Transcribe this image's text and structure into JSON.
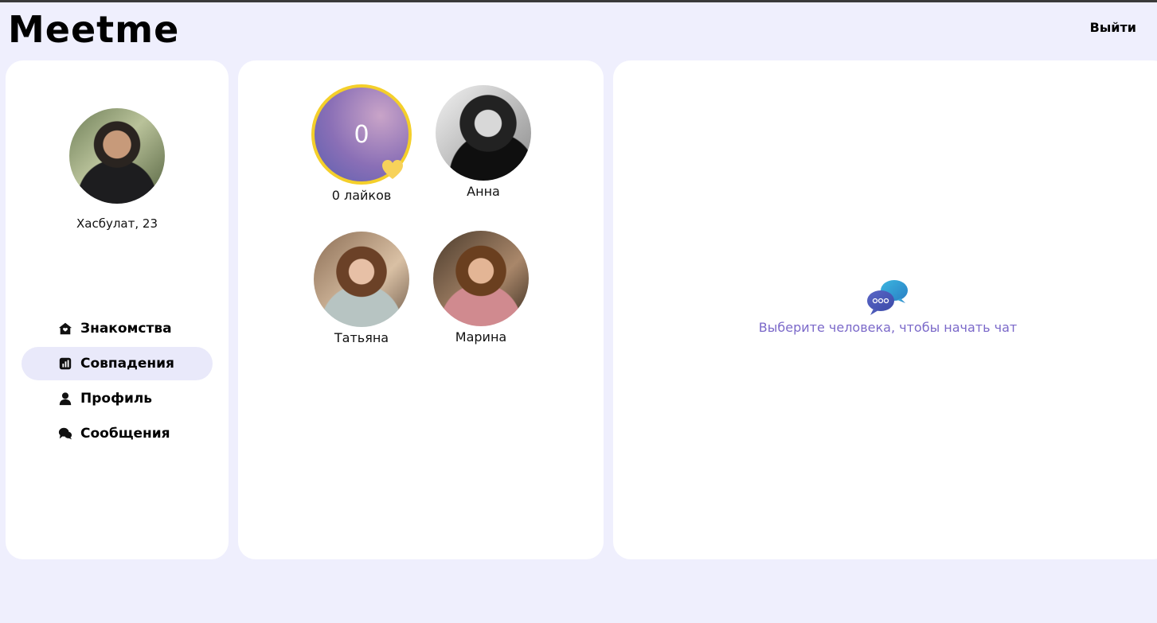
{
  "header": {
    "logo_text": "Meetme",
    "logout_label": "Выйти"
  },
  "profile": {
    "name": "Хасбулат, 23"
  },
  "nav": {
    "items": [
      {
        "label": "Знакомства",
        "icon": "home-heart-icon",
        "active": false
      },
      {
        "label": "Совпадения",
        "icon": "chart-icon",
        "active": true
      },
      {
        "label": "Профиль",
        "icon": "user-icon",
        "active": false
      },
      {
        "label": "Сообщения",
        "icon": "chat-bubbles-icon",
        "active": false
      }
    ]
  },
  "matches": {
    "likes_count": "0",
    "likes_label": "0 лайков",
    "people": [
      {
        "name": "Анна"
      },
      {
        "name": "Татьяна"
      },
      {
        "name": "Марина"
      }
    ]
  },
  "chat": {
    "placeholder": "Выберите человека, чтобы начать чат"
  },
  "colors": {
    "background": "#efeffd",
    "active_nav": "#e9e9fa",
    "likes_border": "#f4cf2a",
    "chat_text": "#7b69c9"
  }
}
